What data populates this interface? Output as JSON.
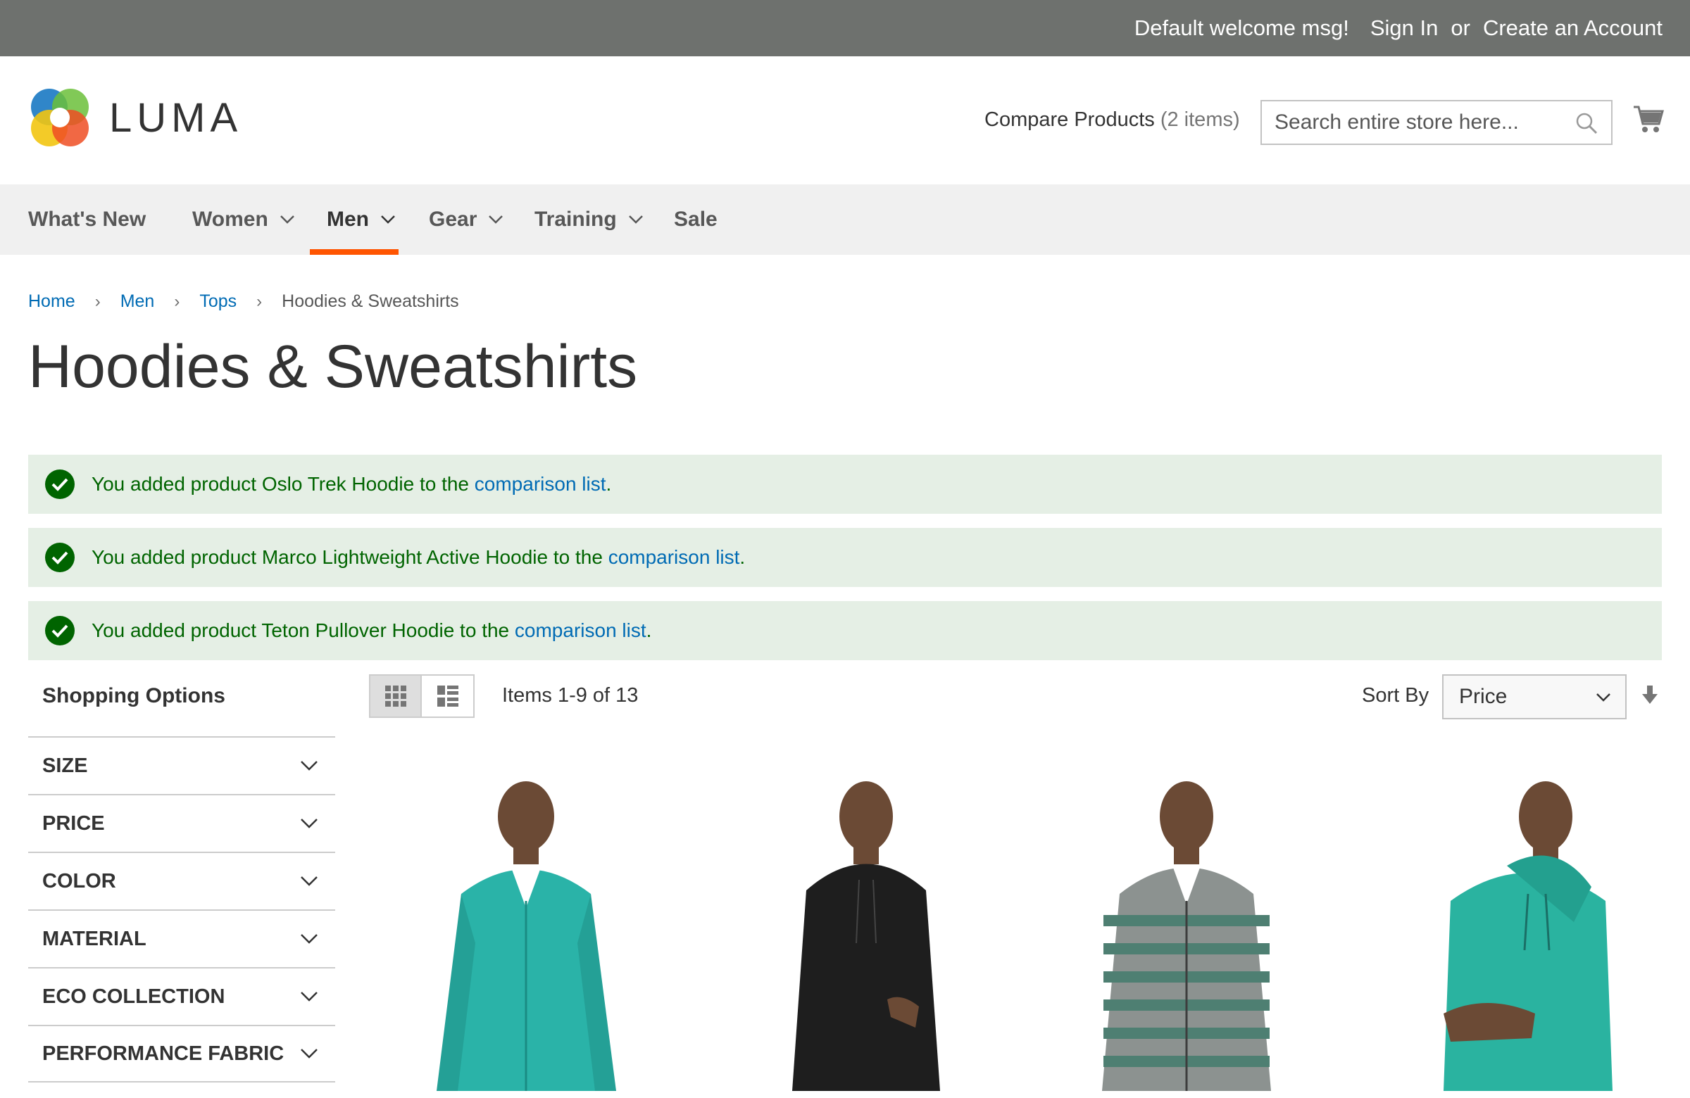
{
  "header_panel": {
    "welcome": "Default welcome msg!",
    "sign_in": "Sign In",
    "or": "or",
    "create_account": "Create an Account"
  },
  "header": {
    "brand": "LUMA",
    "compare_label": "Compare Products",
    "compare_count": "(2 items)",
    "search_placeholder": "Search entire store here...",
    "icons": [
      "search-icon",
      "cart-icon"
    ]
  },
  "nav": {
    "items": [
      {
        "label": "What's New",
        "has_dropdown": false
      },
      {
        "label": "Women",
        "has_dropdown": true
      },
      {
        "label": "Men",
        "has_dropdown": true,
        "active": true
      },
      {
        "label": "Gear",
        "has_dropdown": true
      },
      {
        "label": "Training",
        "has_dropdown": true
      },
      {
        "label": "Sale",
        "has_dropdown": false
      }
    ],
    "accent_color": "#ff5501"
  },
  "breadcrumb": {
    "items": [
      "Home",
      "Men",
      "Tops"
    ],
    "current": "Hoodies & Sweatshirts"
  },
  "page_title": "Hoodies & Sweatshirts",
  "messages": [
    {
      "prefix": "You added product Oslo Trek Hoodie to the ",
      "link": "comparison list",
      "suffix": "."
    },
    {
      "prefix": "You added product Marco Lightweight Active Hoodie to the ",
      "link": "comparison list",
      "suffix": "."
    },
    {
      "prefix": "You added product Teton Pullover Hoodie to the ",
      "link": "comparison list",
      "suffix": "."
    }
  ],
  "sidebar": {
    "title": "Shopping Options",
    "filters": [
      "SIZE",
      "PRICE",
      "COLOR",
      "MATERIAL",
      "ECO COLLECTION",
      "PERFORMANCE FABRIC"
    ]
  },
  "toolbar": {
    "view_modes": [
      "grid",
      "list"
    ],
    "active_mode": "grid",
    "amount": "Items 1-9 of 13",
    "sort_label": "Sort By",
    "sort_value": "Price"
  },
  "products": [
    {
      "image": "teal zip hoodie"
    },
    {
      "image": "black hoodie"
    },
    {
      "image": "grey striped zip hoodie"
    },
    {
      "image": "teal pullover hoodie"
    }
  ],
  "colors": {
    "link": "#006bb4",
    "success_bg": "#e5efe5",
    "success_text": "#006400",
    "topbar_bg": "#6e716e"
  }
}
